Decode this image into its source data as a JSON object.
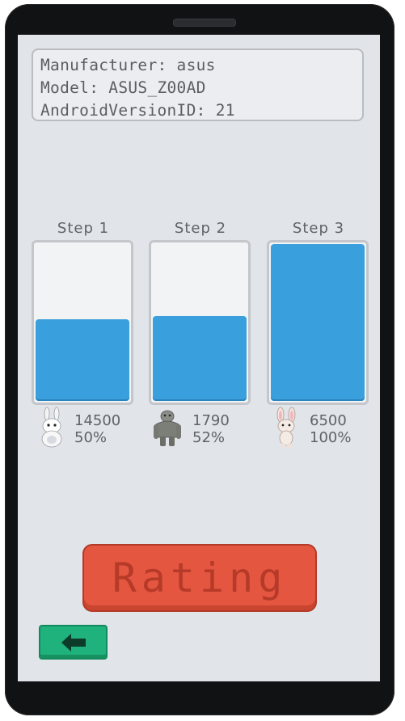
{
  "device_info": {
    "manufacturer": "Manufacturer: asus",
    "model": "Model: ASUS_Z00AD",
    "android_version": "AndroidVersionID: 21"
  },
  "steps": [
    {
      "label": "Step 1",
      "score": "14500",
      "percent": "50%",
      "fill_fraction": 0.52,
      "avatar": "rabbit-icon"
    },
    {
      "label": "Step 2",
      "score": "1790",
      "percent": "52%",
      "fill_fraction": 0.54,
      "avatar": "troll-icon"
    },
    {
      "label": "Step 3",
      "score": "6500",
      "percent": "100%",
      "fill_fraction": 1.0,
      "avatar": "bunny-icon"
    }
  ],
  "rating_button": {
    "label": "Rating"
  },
  "back_button": {
    "icon": "back-arrow-icon"
  },
  "colors": {
    "bar_fill": "#3a9fdd",
    "rating": "#e55640",
    "back": "#1fb27c"
  }
}
